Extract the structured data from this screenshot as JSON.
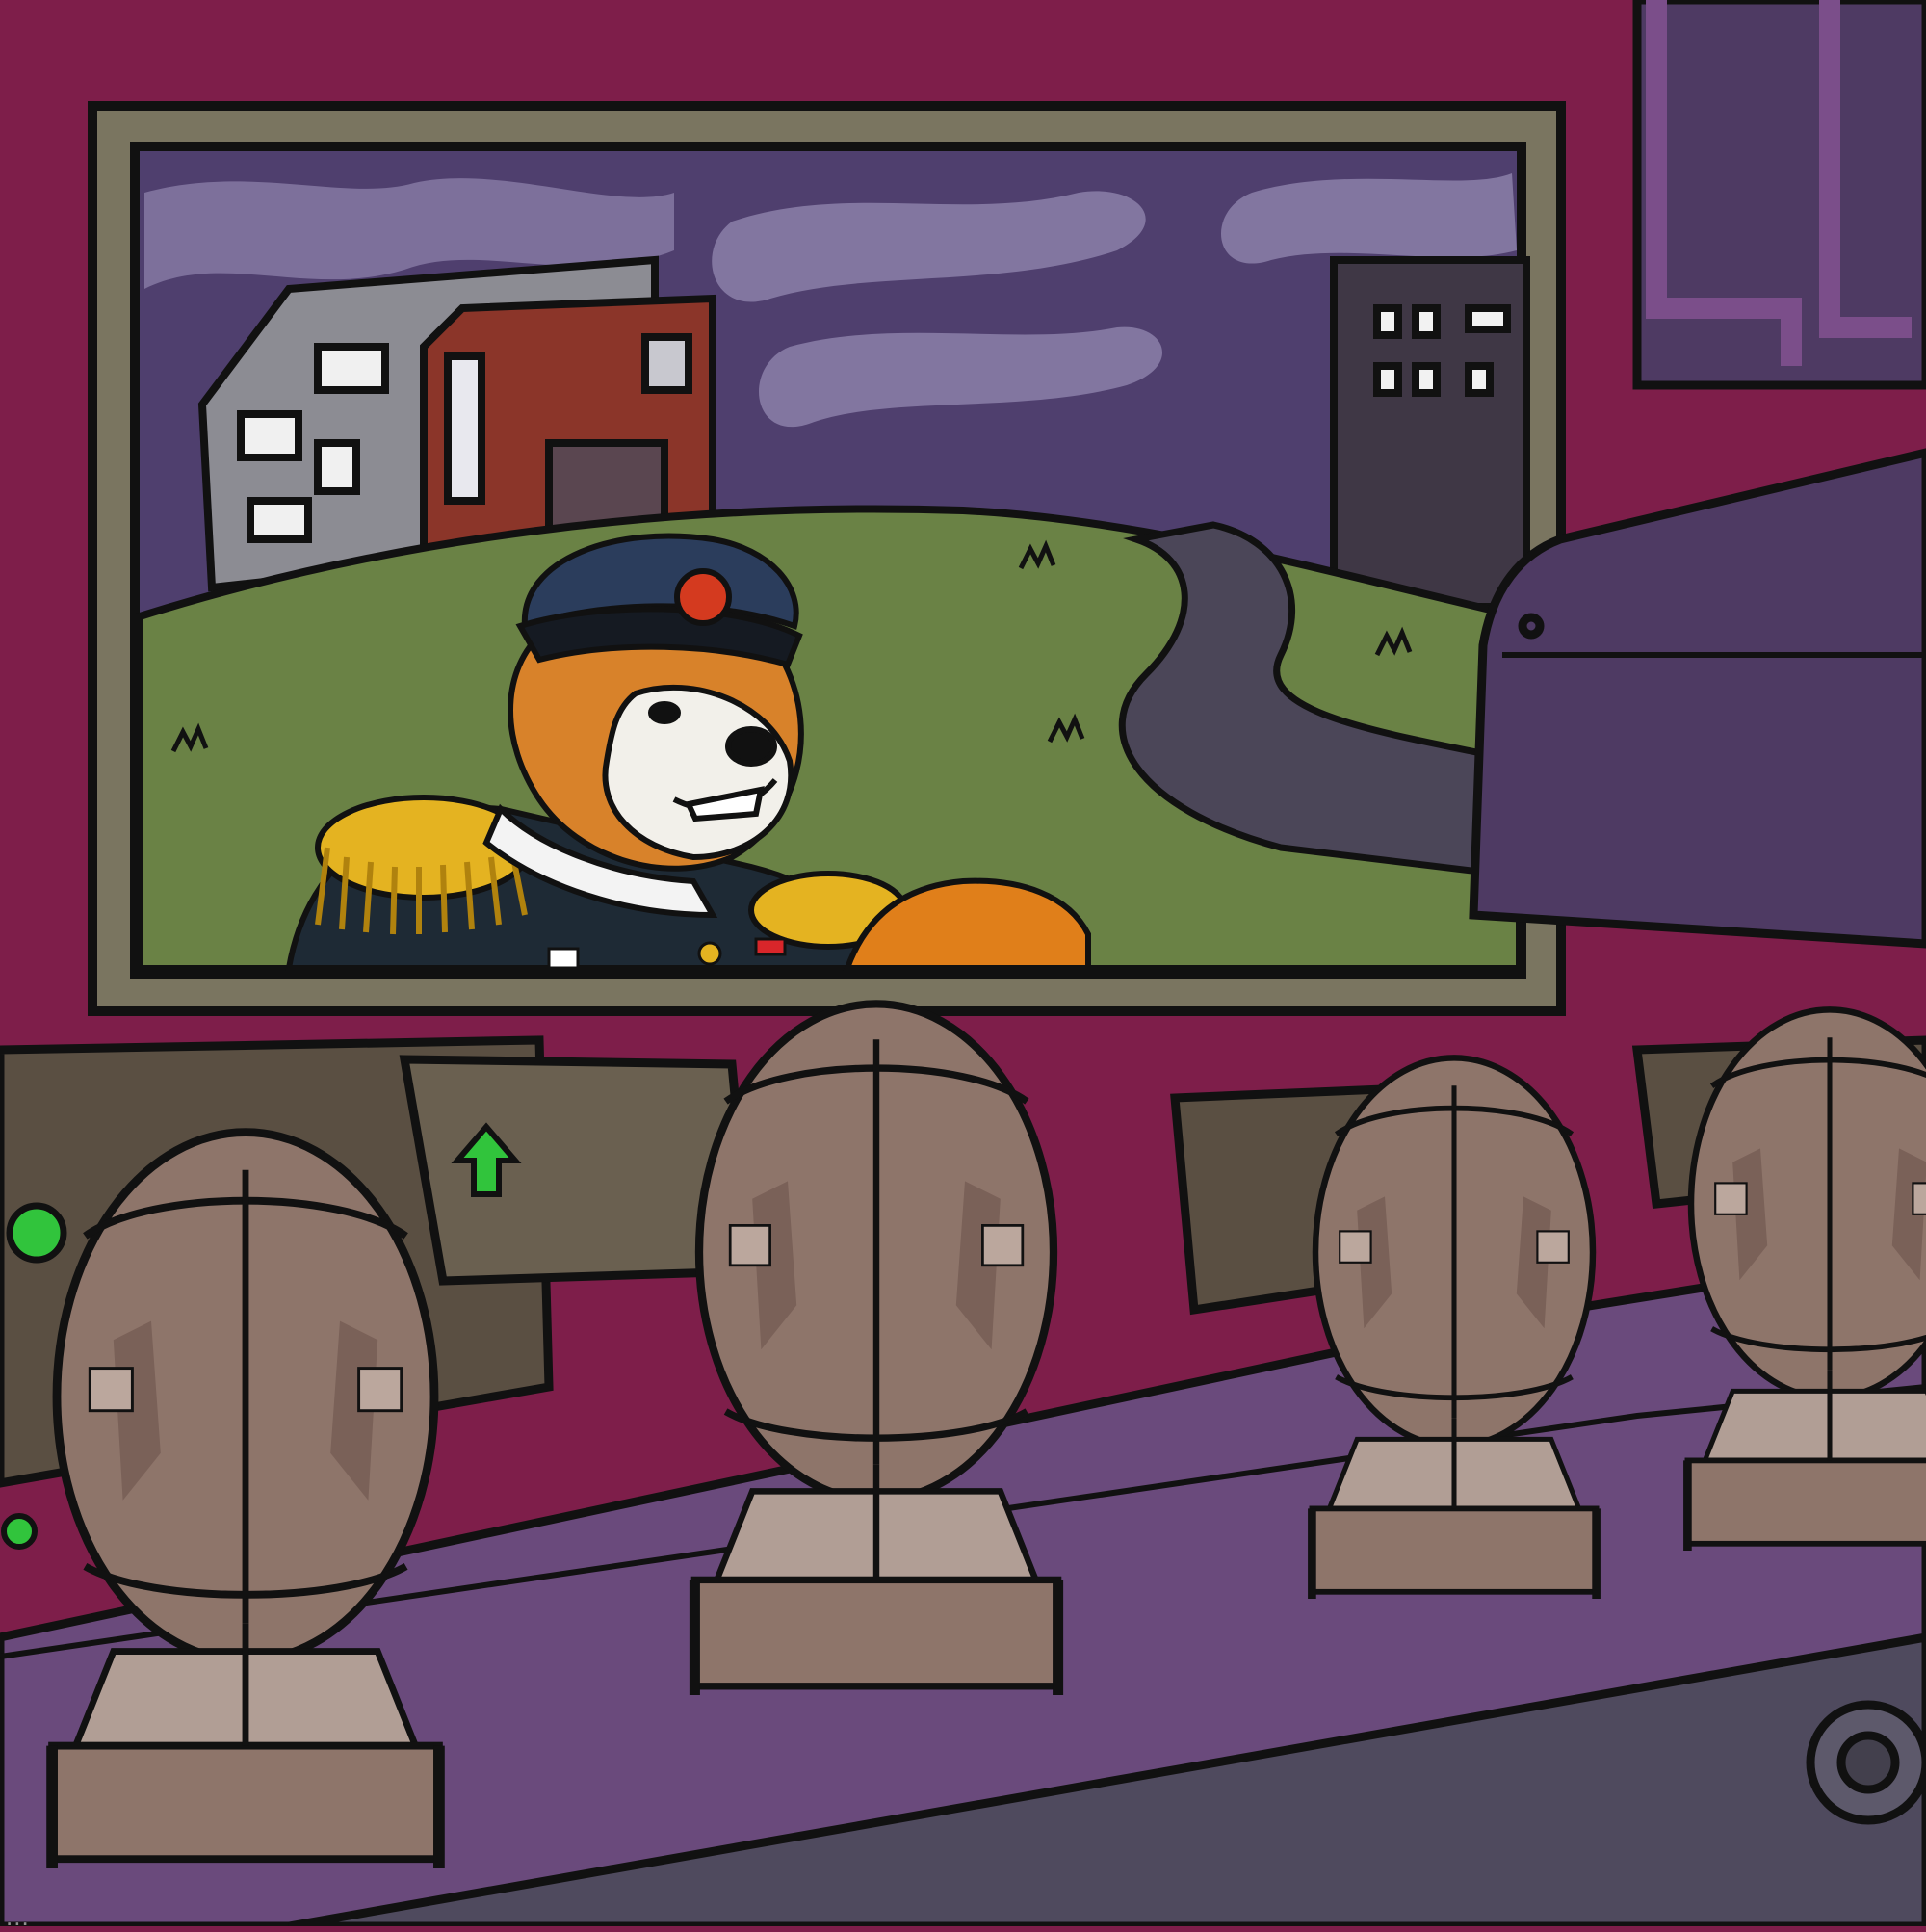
{
  "scene": {
    "description_hidden": false,
    "icons": {
      "monitor": "monitor-screen-icon",
      "arrow": "green-up-arrow-icon",
      "button": "green-button-icon",
      "bomb": "nuclear-bomb-icon",
      "emblem": "cap-emblem-icon",
      "flag": "flag-pin-icon"
    },
    "colors": {
      "wall": "#7e1e4a",
      "monitor_frame": "#7a7560",
      "sky": "#4f3f6e",
      "grass": "#6a8245",
      "road": "#4b4658",
      "conveyor": "#6a4a7c",
      "bomb": "#8e756a",
      "machine": "#4e3a63"
    },
    "bombs": [
      {
        "name": "bomb-front-left"
      },
      {
        "name": "bomb-center"
      },
      {
        "name": "bomb-right"
      },
      {
        "name": "bomb-far-right"
      }
    ]
  },
  "watermark": {
    "text": "..."
  }
}
